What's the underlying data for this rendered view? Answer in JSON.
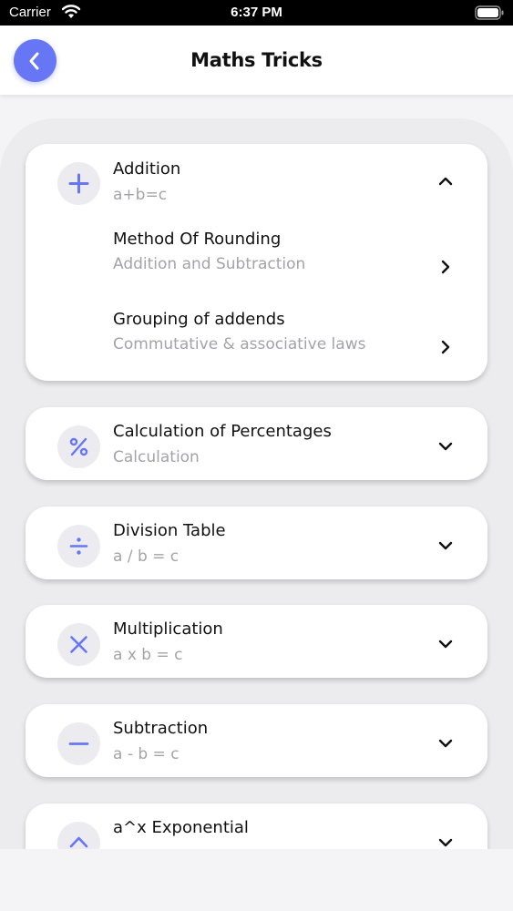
{
  "status_bar": {
    "carrier": "Carrier",
    "time": "6:37 PM"
  },
  "header": {
    "title": "Maths Tricks",
    "back_icon": "chevron-left-icon"
  },
  "accent_color": "#6676f4",
  "categories": [
    {
      "title": "Addition",
      "subtitle": "a+b=c",
      "icon": "plus-icon",
      "expanded": true,
      "items": [
        {
          "title": "Method Of Rounding",
          "subtitle": "Addition and Subtraction"
        },
        {
          "title": "Grouping of addends",
          "subtitle": "Commutative & associative laws"
        }
      ]
    },
    {
      "title": "Calculation of Percentages",
      "subtitle": "Calculation",
      "icon": "percent-icon",
      "expanded": false
    },
    {
      "title": "Division Table",
      "subtitle": "a / b = c",
      "icon": "divide-icon",
      "expanded": false
    },
    {
      "title": "Multiplication",
      "subtitle": "a x b = c",
      "icon": "multiply-icon",
      "expanded": false
    },
    {
      "title": "Subtraction",
      "subtitle": "a - b = c",
      "icon": "minus-icon",
      "expanded": false
    },
    {
      "title": "a^x Exponential",
      "subtitle": "",
      "icon": "caret-up-icon",
      "expanded": false
    }
  ]
}
